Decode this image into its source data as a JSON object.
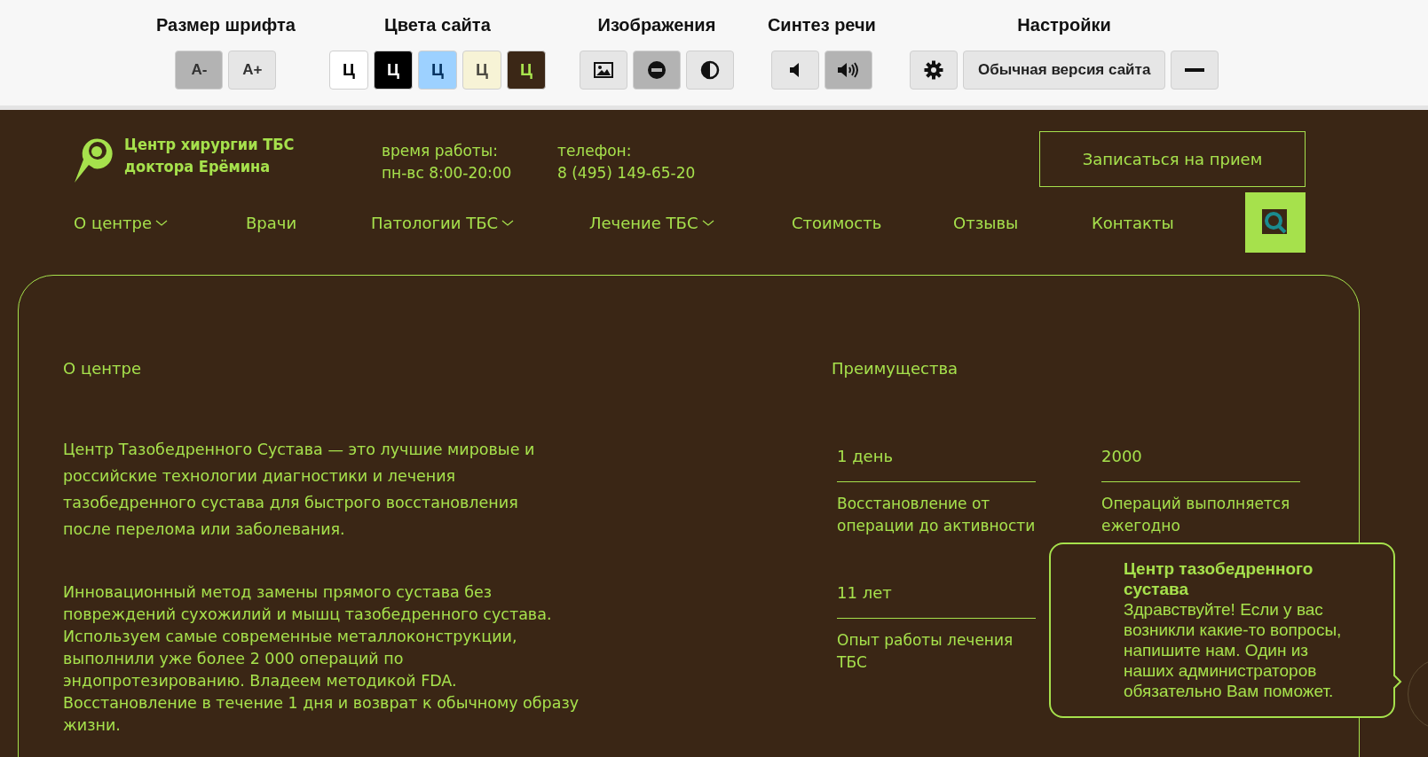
{
  "accessibility_panel": {
    "font_size": {
      "title": "Размер шрифта",
      "buttons": [
        {
          "label": "A-",
          "selected": true
        },
        {
          "label": "A+",
          "selected": false
        }
      ]
    },
    "site_colors": {
      "title": "Цвета сайта",
      "buttons": [
        {
          "label": "Ц",
          "kind": "white"
        },
        {
          "label": "Ц",
          "kind": "black"
        },
        {
          "label": "Ц",
          "kind": "blue"
        },
        {
          "label": "Ц",
          "kind": "beige"
        },
        {
          "label": "Ц",
          "kind": "brown"
        }
      ]
    },
    "images": {
      "title": "Изображения",
      "buttons": [
        {
          "kind": "image",
          "selected": false
        },
        {
          "kind": "mono",
          "selected": true
        },
        {
          "kind": "contrast",
          "selected": false
        }
      ]
    },
    "speech": {
      "title": "Синтез речи",
      "buttons": [
        {
          "kind": "off",
          "selected": false
        },
        {
          "kind": "on",
          "selected": true
        }
      ]
    },
    "settings": {
      "title": "Настройки",
      "normal_version": "Обычная версия сайта"
    }
  },
  "header": {
    "logo": [
      "Центр хирургии ТБС",
      "доктора Ерёмина"
    ],
    "hours": {
      "label": "время работы:",
      "value": "пн-вс 8:00-20:00"
    },
    "phone": {
      "label": "телефон:",
      "value": "8 (495) 149-65-20"
    },
    "appointment_button": "Записаться на прием",
    "nav": [
      {
        "label": "О центре",
        "has_dropdown": true
      },
      {
        "label": "Врачи",
        "has_dropdown": false
      },
      {
        "label": "Патологии ТБС",
        "has_dropdown": true
      },
      {
        "label": "Лечение ТБС",
        "has_dropdown": true
      },
      {
        "label": "Стоимость",
        "has_dropdown": false
      },
      {
        "label": "Отзывы",
        "has_dropdown": false
      },
      {
        "label": "Контакты",
        "has_dropdown": false
      }
    ]
  },
  "about": {
    "title": "О центре",
    "paragraphs": [
      "Центр Тазобедренного Сустава — это лучшие мировые и российские технологии диагностики и лечения тазобедренного сустава для быстрого восстановления после перелома или заболевания.",
      "Инновационный метод замены прямого сустава без повреждений сухожилий и мышц тазобедренного сустава. Используем самые современные металлоконструкции, выполнили уже более 2 000 операций по эндопротезированию. Владеем методикой FDA. Восстановление в течение 1 дня и возврат к обычному образу жизни."
    ]
  },
  "advantages": {
    "title": "Преимущества",
    "items": [
      {
        "value": "1 день",
        "description": "Восстановление от операции до активности"
      },
      {
        "value": "2000",
        "description": "Операций выполняется ежегодно"
      },
      {
        "value": "11 лет",
        "description": "Опыт работы лечения ТБС"
      }
    ]
  },
  "chat_popup": {
    "title": "Центр тазобедренного сустава",
    "message": "Здравствуйте! Если у вас возникли какие-то вопросы, напишите нам. Один из наших администраторов обязательно Вам поможет."
  }
}
